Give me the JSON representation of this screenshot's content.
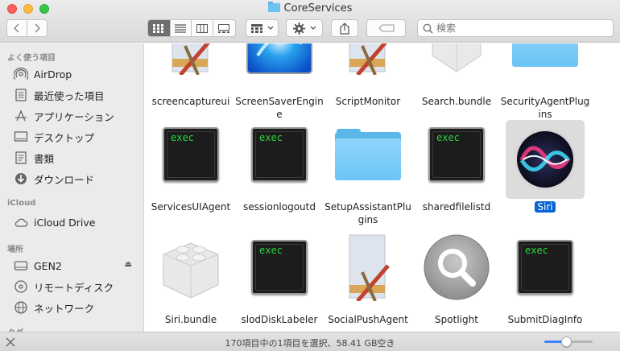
{
  "window": {
    "title": "CoreServices"
  },
  "toolbar": {
    "search_placeholder": "検索"
  },
  "sidebar": {
    "sections": [
      {
        "heading": "よく使う項目"
      },
      {
        "heading": "iCloud"
      },
      {
        "heading": "場所"
      },
      {
        "heading": "タグ"
      }
    ],
    "favorites": [
      {
        "label": "AirDrop",
        "icon": "airdrop-icon"
      },
      {
        "label": "最近使った項目",
        "icon": "recents-icon"
      },
      {
        "label": "アプリケーション",
        "icon": "applications-icon"
      },
      {
        "label": "デスクトップ",
        "icon": "desktop-icon"
      },
      {
        "label": "書類",
        "icon": "documents-icon"
      },
      {
        "label": "ダウンロード",
        "icon": "downloads-icon"
      }
    ],
    "icloud": [
      {
        "label": "iCloud Drive",
        "icon": "cloud-icon"
      }
    ],
    "locations": [
      {
        "label": "GEN2",
        "icon": "drive-icon"
      },
      {
        "label": "リモートディスク",
        "icon": "disc-icon"
      },
      {
        "label": "ネットワーク",
        "icon": "network-icon"
      }
    ]
  },
  "files": [
    {
      "name": "screencaptureui",
      "kind": "app"
    },
    {
      "name": "ScreenSaverEngine",
      "kind": "screensaver"
    },
    {
      "name": "ScriptMonitor",
      "kind": "app"
    },
    {
      "name": "Search.bundle",
      "kind": "bundle"
    },
    {
      "name": "SecurityAgentPlugins",
      "kind": "folder"
    },
    {
      "name": "ServicesUIAgent",
      "kind": "exec"
    },
    {
      "name": "sessionlogoutd",
      "kind": "exec"
    },
    {
      "name": "SetupAssistantPlugins",
      "kind": "folder"
    },
    {
      "name": "sharedfilelistd",
      "kind": "exec"
    },
    {
      "name": "Siri",
      "kind": "siri",
      "selected": true
    },
    {
      "name": "Siri.bundle",
      "kind": "bundle"
    },
    {
      "name": "slodDiskLabeler",
      "kind": "exec"
    },
    {
      "name": "SocialPushAgent",
      "kind": "app"
    },
    {
      "name": "Spotlight",
      "kind": "spotlight"
    },
    {
      "name": "SubmitDiagInfo",
      "kind": "exec"
    }
  ],
  "exec_label": "exec",
  "status": {
    "text": "170項目中の1項目を選択、58.41 GB空き",
    "icon_size_level": 0.45
  },
  "colors": {
    "selection": "#0a63d6",
    "exec_text": "#27d93b",
    "folder": "#6cc4f6"
  }
}
